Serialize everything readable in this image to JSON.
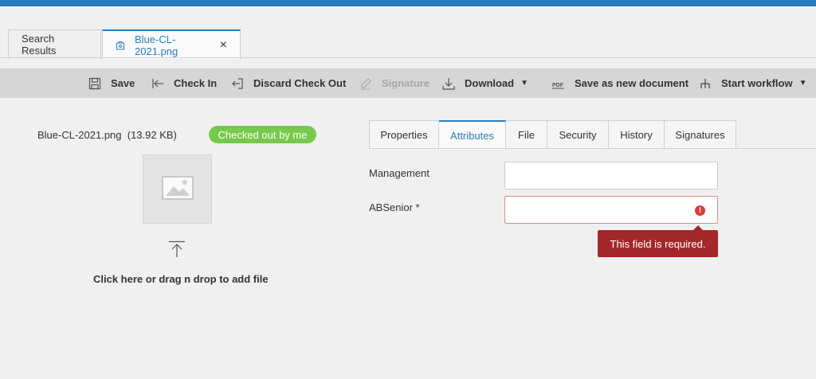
{
  "doc_tabs": [
    {
      "label": "Search Results",
      "active": false
    },
    {
      "label": "Blue-CL-2021.png",
      "active": true,
      "icon": "checked-out-doc-icon"
    }
  ],
  "toolbar": {
    "save": "Save",
    "check_in": "Check In",
    "discard_check_out": "Discard Check Out",
    "signature": "Signature",
    "download": "Download",
    "save_as_new": "Save as new document",
    "start_workflow": "Start workflow"
  },
  "file": {
    "name_size": "Blue-CL-2021.png  (13.92 KB)",
    "status_badge": "Checked out by me",
    "drop_text": "Click here or drag n drop to add file"
  },
  "attr_tabs": [
    "Properties",
    "Attributes",
    "File",
    "Security",
    "History",
    "Signatures"
  ],
  "attr_tabs_active": "Attributes",
  "fields": {
    "management_label": "Management",
    "management_value": "",
    "absenior_label": "ABSenior *",
    "absenior_value": "",
    "error_message": "This field is required."
  },
  "colors": {
    "accent": "#2b7bbd",
    "badge": "#77c94b",
    "error": "#a4282a"
  }
}
